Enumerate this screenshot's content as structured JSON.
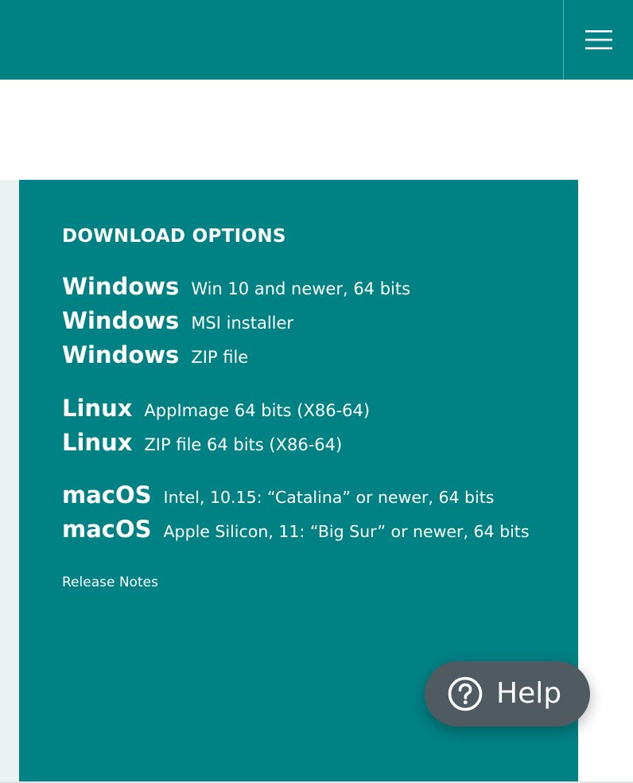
{
  "header": {
    "menu_icon": "hamburger-icon",
    "background": "#008184"
  },
  "download": {
    "title": "DOWNLOAD OPTIONS",
    "background": "#008184",
    "windows": [
      {
        "os": "Windows",
        "desc": "Win 10 and newer, 64 bits"
      },
      {
        "os": "Windows",
        "desc": "MSI installer"
      },
      {
        "os": "Windows",
        "desc": "ZIP file"
      }
    ],
    "linux": [
      {
        "os": "Linux",
        "desc": "AppImage 64 bits (X86-64)"
      },
      {
        "os": "Linux",
        "desc": "ZIP file 64 bits (X86-64)"
      }
    ],
    "macos": [
      {
        "os": "macOS",
        "desc": "Intel, 10.15: “Catalina” or newer, 64 bits"
      },
      {
        "os": "macOS",
        "desc": "Apple Silicon, 11: “Big Sur” or newer, 64 bits"
      }
    ],
    "release_notes": "Release Notes"
  },
  "help_button": {
    "label": "Help",
    "icon": "question-circle-icon",
    "background": "#4f5b60"
  }
}
